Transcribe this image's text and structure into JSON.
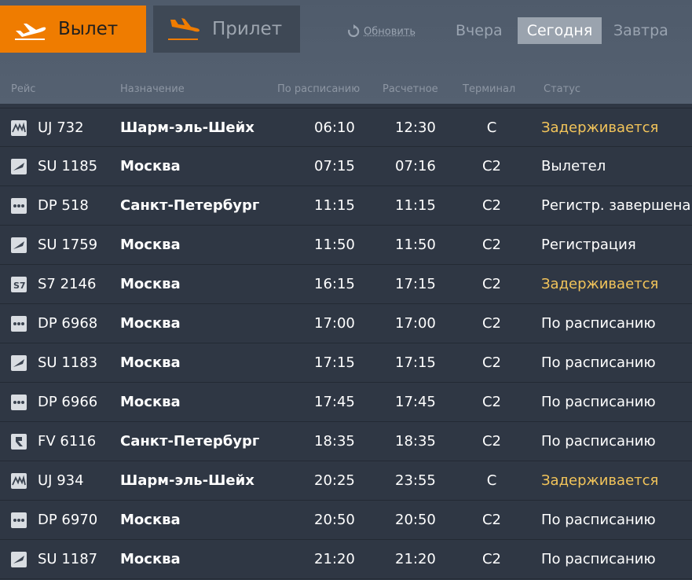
{
  "modes": {
    "departure": "Вылет",
    "arrival": "Прилет"
  },
  "refresh": "Обновить",
  "days": {
    "yesterday": "Вчера",
    "today": "Сегодня",
    "tomorrow": "Завтра"
  },
  "columns": {
    "flight": "Рейс",
    "destination": "Назначение",
    "scheduled": "По расписанию",
    "estimated": "Расчетное",
    "terminal": "Терминал",
    "status": "Статус"
  },
  "colors": {
    "accent": "#ef7c00",
    "delayed": "#f2c45a"
  },
  "flights": [
    {
      "logo": "uj-airline-icon",
      "flight": "UJ 732",
      "destination": "Шарм-эль-Шейх",
      "scheduled": "06:10",
      "estimated": "12:30",
      "terminal": "C",
      "status": "Задерживается",
      "delayed": true
    },
    {
      "logo": "su-airline-icon",
      "flight": "SU 1185",
      "destination": "Москва",
      "scheduled": "07:15",
      "estimated": "07:16",
      "terminal": "C2",
      "status": "Вылетел",
      "delayed": false
    },
    {
      "logo": "dp-airline-icon",
      "flight": "DP 518",
      "destination": "Санкт-Петербург",
      "scheduled": "11:15",
      "estimated": "11:15",
      "terminal": "C2",
      "status": "Регистр. завершена",
      "delayed": false
    },
    {
      "logo": "su-airline-icon",
      "flight": "SU 1759",
      "destination": "Москва",
      "scheduled": "11:50",
      "estimated": "11:50",
      "terminal": "C2",
      "status": "Регистрация",
      "delayed": false
    },
    {
      "logo": "s7-airline-icon",
      "flight": "S7 2146",
      "destination": "Москва",
      "scheduled": "16:15",
      "estimated": "17:15",
      "terminal": "C2",
      "status": "Задерживается",
      "delayed": true
    },
    {
      "logo": "dp-airline-icon",
      "flight": "DP 6968",
      "destination": "Москва",
      "scheduled": "17:00",
      "estimated": "17:00",
      "terminal": "C2",
      "status": "По расписанию",
      "delayed": false
    },
    {
      "logo": "su-airline-icon",
      "flight": "SU 1183",
      "destination": "Москва",
      "scheduled": "17:15",
      "estimated": "17:15",
      "terminal": "C2",
      "status": "По расписанию",
      "delayed": false
    },
    {
      "logo": "dp-airline-icon",
      "flight": "DP 6966",
      "destination": "Москва",
      "scheduled": "17:45",
      "estimated": "17:45",
      "terminal": "C2",
      "status": "По расписанию",
      "delayed": false
    },
    {
      "logo": "fv-airline-icon",
      "flight": "FV 6116",
      "destination": "Санкт-Петербург",
      "scheduled": "18:35",
      "estimated": "18:35",
      "terminal": "C2",
      "status": "По расписанию",
      "delayed": false
    },
    {
      "logo": "uj-airline-icon",
      "flight": "UJ 934",
      "destination": "Шарм-эль-Шейх",
      "scheduled": "20:25",
      "estimated": "23:55",
      "terminal": "C",
      "status": "Задерживается",
      "delayed": true
    },
    {
      "logo": "dp-airline-icon",
      "flight": "DP 6970",
      "destination": "Москва",
      "scheduled": "20:50",
      "estimated": "20:50",
      "terminal": "C2",
      "status": "По расписанию",
      "delayed": false
    },
    {
      "logo": "su-airline-icon",
      "flight": "SU 1187",
      "destination": "Москва",
      "scheduled": "21:20",
      "estimated": "21:20",
      "terminal": "C2",
      "status": "По расписанию",
      "delayed": false
    }
  ]
}
